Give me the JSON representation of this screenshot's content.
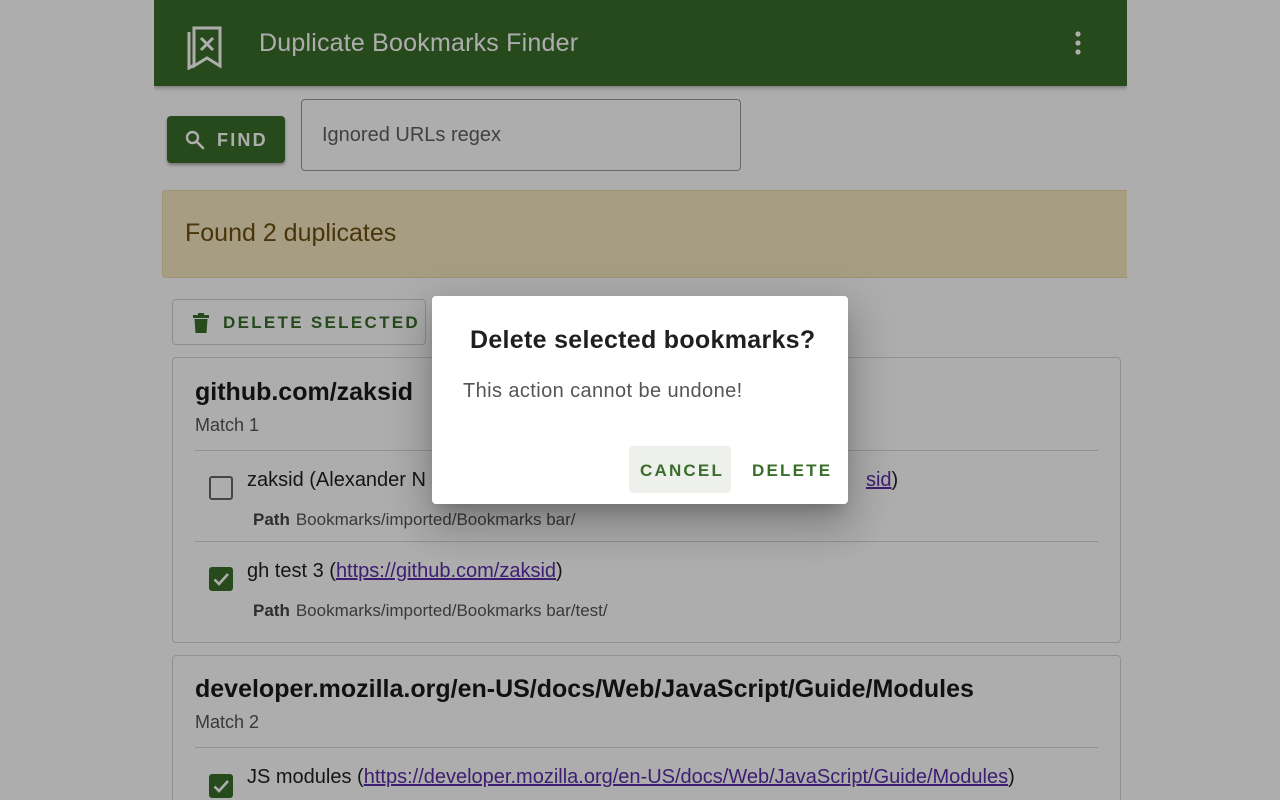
{
  "app": {
    "title": "Duplicate Bookmarks Finder"
  },
  "toolbar": {
    "find_label": "FIND",
    "ignored_placeholder": "Ignored URLs regex"
  },
  "banner": {
    "text": "Found 2 duplicates"
  },
  "actions": {
    "delete_selected_label": "DELETE SELECTED"
  },
  "groups": [
    {
      "title": "github.com/zaksid",
      "match": "Match 1",
      "bookmarks": [
        {
          "checked": false,
          "name": "zaksid (Alexander N",
          "url_visible": "sid",
          "close": ")",
          "path_label": "Path",
          "path": "Bookmarks/imported/Bookmarks bar/"
        },
        {
          "checked": true,
          "name": "gh test 3 (",
          "url": "https://github.com/zaksid",
          "close": ")",
          "path_label": "Path",
          "path": "Bookmarks/imported/Bookmarks bar/test/"
        }
      ]
    },
    {
      "title": "developer.mozilla.org/en-US/docs/Web/JavaScript/Guide/Modules",
      "match": "Match 2",
      "bookmarks": [
        {
          "checked": true,
          "name": "JS modules (",
          "url": "https://developer.mozilla.org/en-US/docs/Web/JavaScript/Guide/Modules",
          "close": ")"
        }
      ]
    }
  ],
  "dialog": {
    "title": "Delete selected bookmarks?",
    "body": "This action cannot be undone!",
    "cancel_label": "CANCEL",
    "delete_label": "DELETE"
  },
  "icons": {
    "logo": "bookmark-x-icon",
    "menu": "more-vert-icon",
    "find": "search-icon",
    "delete_selected": "trash-icon",
    "checkbox_checked": "check-icon"
  },
  "colors": {
    "primary": "#3a6e2a",
    "banner_bg": "#f7e8c0",
    "banner_text": "#6b4f10",
    "link": "#5b2da8"
  }
}
